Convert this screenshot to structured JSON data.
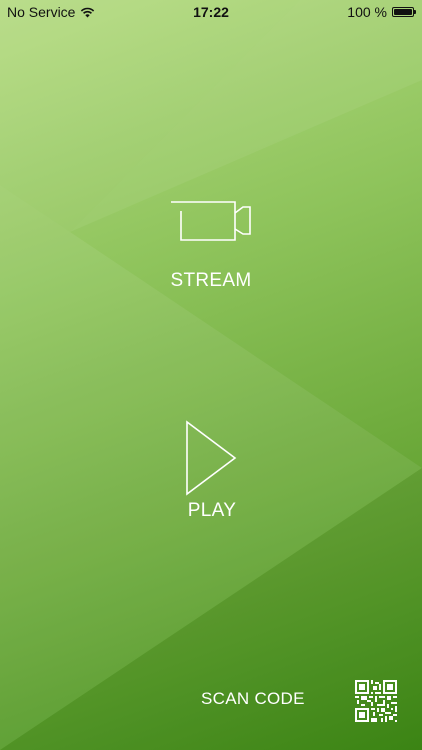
{
  "status_bar": {
    "carrier": "No Service",
    "time": "17:22",
    "battery": "100 %",
    "battery_level": 1.0
  },
  "actions": {
    "stream_label": "STREAM",
    "play_label": "PLAY",
    "scan_label": "SCAN CODE"
  },
  "icons": {
    "signal": "wifi-icon",
    "battery": "battery-icon",
    "stream": "video-camera-icon",
    "play": "play-icon",
    "scan": "qr-code-icon"
  },
  "colors": {
    "background_light": "#b7dc85",
    "background_dark": "#3f8c16",
    "foreground": "#ffffff"
  }
}
